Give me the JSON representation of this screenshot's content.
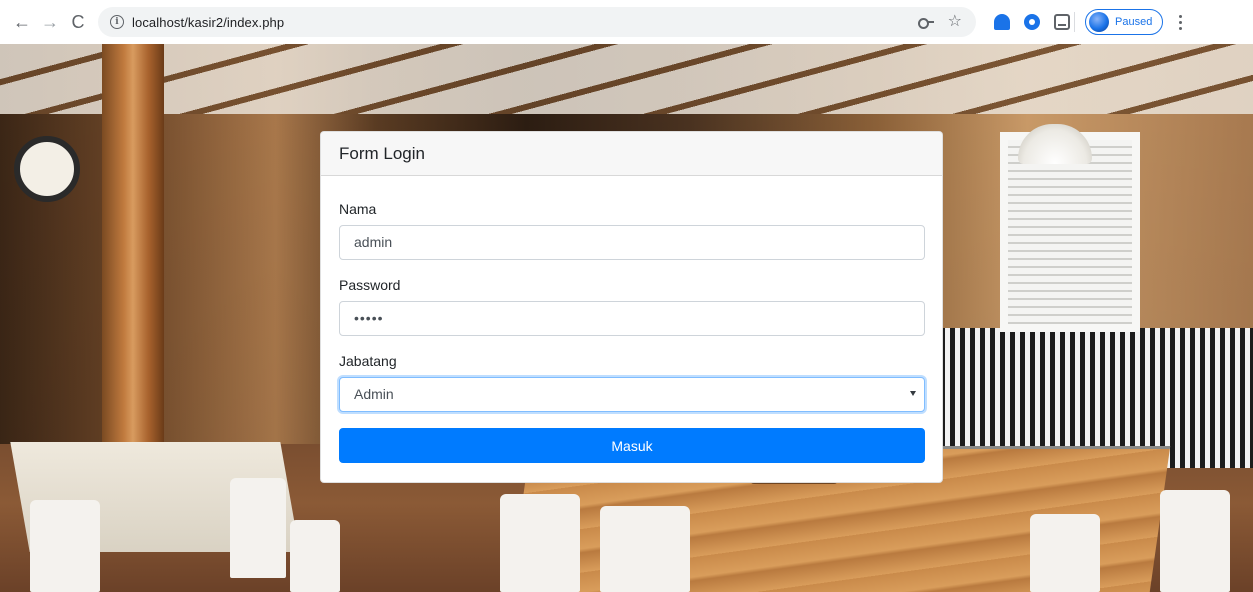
{
  "browser": {
    "url": "localhost/kasir2/index.php",
    "profile_status": "Paused",
    "icons": {
      "back": "back-arrow-icon",
      "forward": "forward-arrow-icon",
      "reload": "reload-icon",
      "site_info": "info-icon",
      "password": "key-icon",
      "bookmark": "star-icon",
      "menu": "kebab-menu-icon"
    },
    "glyphs": {
      "back": "←",
      "forward": "→",
      "reload": "C",
      "info": "i",
      "star": "☆"
    }
  },
  "login_form": {
    "title": "Form Login",
    "fields": {
      "nama": {
        "label": "Nama",
        "value": "admin"
      },
      "password": {
        "label": "Password",
        "masked_value": "•••••"
      },
      "jabatan": {
        "label": "Jabatang",
        "selected": "Admin"
      }
    },
    "submit_label": "Masuk"
  },
  "colors": {
    "primary": "#007bff",
    "header_bg": "#f7f7f7",
    "focus_border": "#80bdff"
  }
}
